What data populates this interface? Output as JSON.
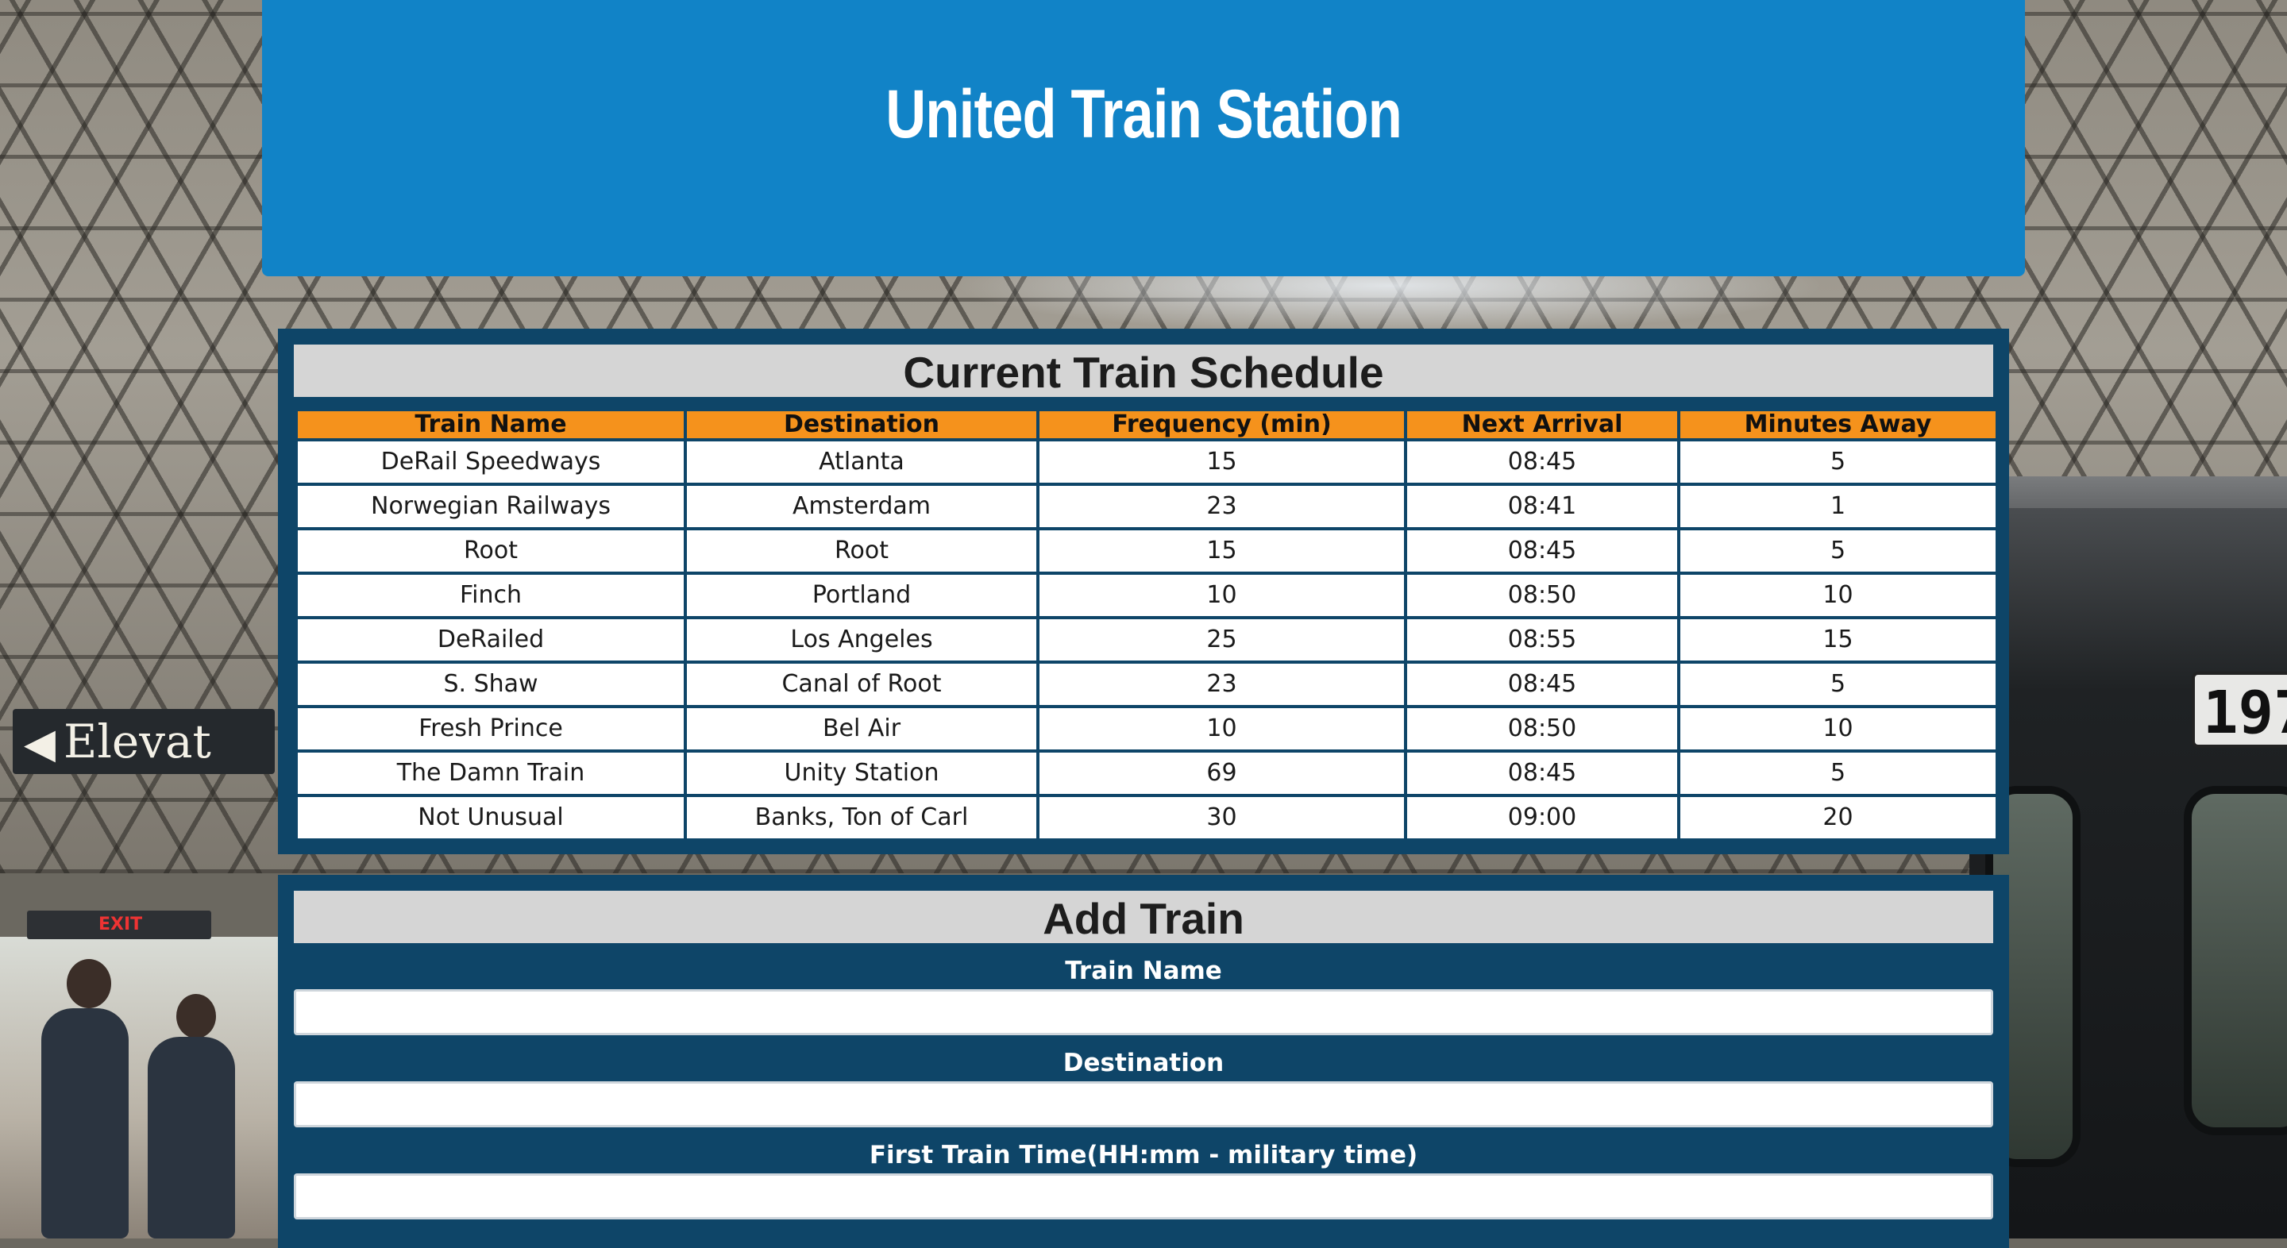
{
  "header": {
    "title": "United Train Station"
  },
  "background": {
    "elevator_sign": "Elevat",
    "exit_sign": "EXIT",
    "train_number": "197"
  },
  "schedule": {
    "heading": "Current Train Schedule",
    "columns": [
      "Train Name",
      "Destination",
      "Frequency (min)",
      "Next Arrival",
      "Minutes Away"
    ],
    "rows": [
      [
        "DeRail Speedways",
        "Atlanta",
        "15",
        "08:45",
        "5"
      ],
      [
        "Norwegian Railways",
        "Amsterdam",
        "23",
        "08:41",
        "1"
      ],
      [
        "Root",
        "Root",
        "15",
        "08:45",
        "5"
      ],
      [
        "Finch",
        "Portland",
        "10",
        "08:50",
        "10"
      ],
      [
        "DeRailed",
        "Los Angeles",
        "25",
        "08:55",
        "15"
      ],
      [
        "S. Shaw",
        "Canal of Root",
        "23",
        "08:45",
        "5"
      ],
      [
        "Fresh Prince",
        "Bel Air",
        "10",
        "08:50",
        "10"
      ],
      [
        "The Damn Train",
        "Unity Station",
        "69",
        "08:45",
        "5"
      ],
      [
        "Not Unusual",
        "Banks, Ton of Carl",
        "30",
        "09:00",
        "20"
      ]
    ]
  },
  "add_train": {
    "heading": "Add Train",
    "train_name_label": "Train Name",
    "train_name_value": "",
    "destination_label": "Destination",
    "destination_value": "",
    "first_time_label": "First Train Time(HH:mm - military time)",
    "first_time_value": ""
  },
  "colors": {
    "header_blue": "#1183c7",
    "panel_navy": "#0e4568",
    "table_header_orange": "#f5921c",
    "heading_gray": "#d5d5d5"
  }
}
